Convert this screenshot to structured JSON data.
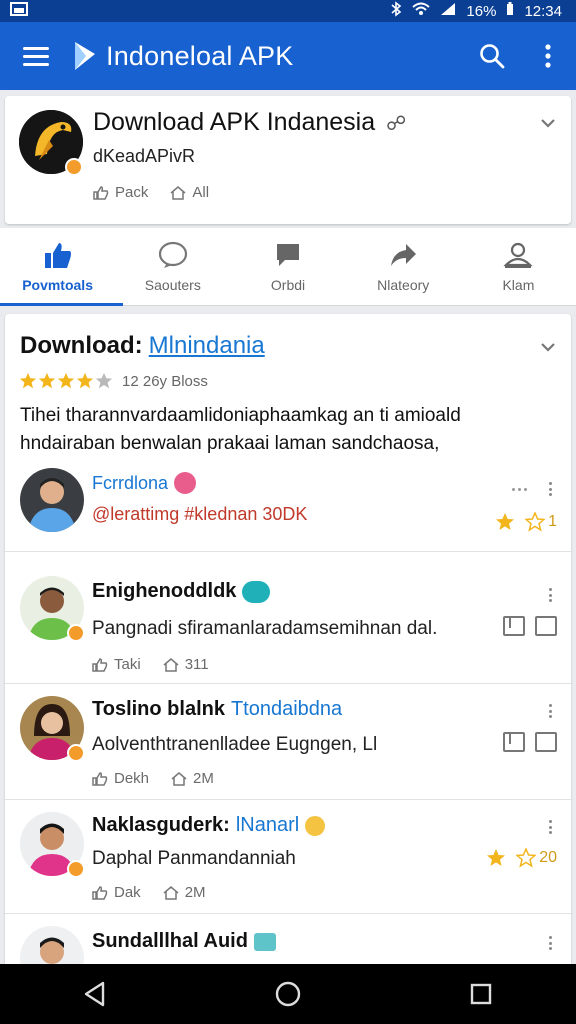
{
  "status_bar": {
    "battery_text": "16%",
    "time": "12:34"
  },
  "app_bar": {
    "title": "Indoneloal APK",
    "search_icon": "search-icon",
    "more_icon": "more-vert-icon"
  },
  "top_card": {
    "title": "Download APK Indanesia",
    "subtitle": "dKeadAPivR",
    "meta": [
      {
        "icon": "thumb-icon",
        "label": "Pack"
      },
      {
        "icon": "reshare-icon",
        "label": "All"
      }
    ]
  },
  "tabs": [
    {
      "label": "Povmtoals",
      "icon": "thumb-up-icon",
      "active": true
    },
    {
      "label": "Saouters",
      "icon": "heart-icon",
      "active": false
    },
    {
      "label": "Orbdi",
      "icon": "comment-icon",
      "active": false
    },
    {
      "label": "Nlateory",
      "icon": "share-icon",
      "active": false
    },
    {
      "label": "Klam",
      "icon": "profile-icon",
      "active": false
    }
  ],
  "main_card": {
    "title": "Download:",
    "title_link": "Mlnindania",
    "rating_stars": 4,
    "rating_text": "12 26y Bloss",
    "description": "Tihei tharannvardaamlidoniaphaamkag an ti amioald hndairaban benwalan prakaai laman sandchaosa,",
    "posts": [
      {
        "name": "Fcrrdlona",
        "line": "@lerattimg #klednan 30DK",
        "score": "1",
        "more_icon": "more-vert-icon"
      },
      {
        "name": "Enighenoddldk",
        "line": "Pangnadi sfiramanlaradamsemihnan dal.",
        "meta": [
          "Taki",
          "311"
        ],
        "more_icon": "more-vert-icon"
      },
      {
        "name": "Toslino blalnk",
        "handle": "Ttondaibdna",
        "line": "Aolventhtranenlladee Eugngen, Ll",
        "meta": [
          "Dekh",
          "2M"
        ],
        "more_icon": "more-vert-icon"
      },
      {
        "name": "Naklasguderk:",
        "handle": "lNanarl",
        "line": "Daphal Panmandanniah",
        "meta": [
          "Dak",
          "2M"
        ],
        "score": "20",
        "more_icon": "more-vert-icon"
      },
      {
        "name": "Sundalllhal Auid",
        "more_icon": "more-vert-icon"
      }
    ]
  },
  "colors": {
    "primary": "#1761d0",
    "link": "#1877d2",
    "star": "#f2b51c",
    "badge": "#f39c2b"
  }
}
